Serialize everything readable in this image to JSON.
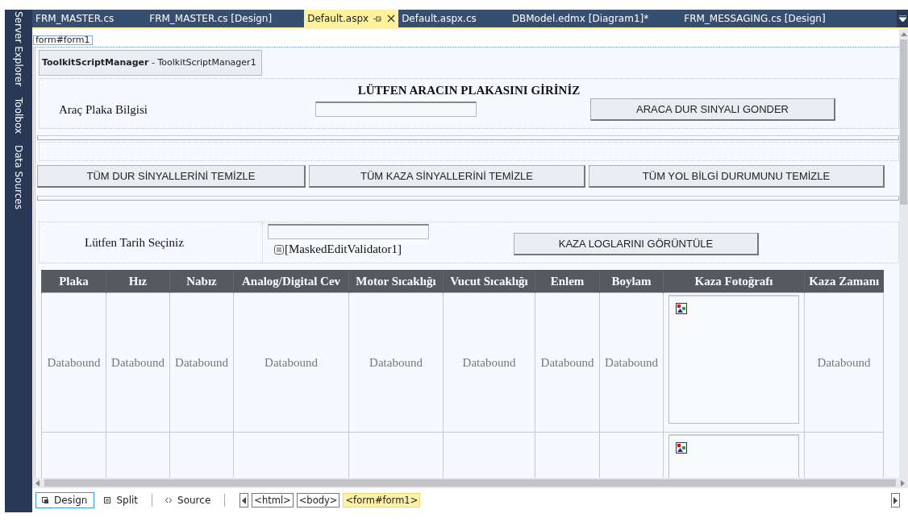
{
  "side_panels": [
    {
      "label": "Server Explorer"
    },
    {
      "label": "Toolbox"
    },
    {
      "label": "Data Sources"
    }
  ],
  "tabs": [
    {
      "label": "FRM_MASTER.cs",
      "selected": false
    },
    {
      "label": "FRM_MASTER.cs [Design]",
      "selected": false
    },
    {
      "label": "Default.aspx",
      "selected": true
    },
    {
      "label": "Default.aspx.cs",
      "selected": false
    },
    {
      "label": "DBModel.edmx [Diagram1]*",
      "selected": false
    },
    {
      "label": "FRM_MESSAGING.cs [Design]",
      "selected": false
    }
  ],
  "designer": {
    "element_tag": "form#form1",
    "script_manager": "**ToolkitScriptManager** - ToolkitScriptManager1",
    "heading": "LÜTFEN ARACIN PLAKASINI GİRİNİZ",
    "plate_label": "Araç Plaka Bilgisi",
    "send_button": "ARACA DUR SINYALI GONDER",
    "clear_buttons": [
      "TÜM DUR SİNYALLERİNİ TEMİZLE",
      "TÜM KAZA SİNYALLERİNİ TEMİZLE",
      "TÜM YOL BİLGİ DURUMUNU TEMİZLE"
    ],
    "date_label": "Lütfen Tarih Seçiniz",
    "validator": "[MaskedEditValidator1]",
    "logs_button": "KAZA LOGLARINI GÖRÜNTÜLE",
    "table": {
      "columns": [
        "Plaka",
        "Hız",
        "Nabız",
        "Analog/Digital Cev",
        "Motor Sıcaklığı",
        "Vucut Sıcaklığı",
        "Enlem",
        "Boylam",
        "Kaza Fotoğrafı",
        "Kaza Zamanı"
      ],
      "rows": [
        {
          "cells": [
            {
              "kind": "text",
              "text": "Databound"
            },
            {
              "kind": "text",
              "text": "Databound"
            },
            {
              "kind": "text",
              "text": "Databound"
            },
            {
              "kind": "text",
              "text": "Databound"
            },
            {
              "kind": "text",
              "text": "Databound"
            },
            {
              "kind": "text",
              "text": "Databound"
            },
            {
              "kind": "text",
              "text": "Databound"
            },
            {
              "kind": "text",
              "text": "Databound"
            },
            {
              "kind": "image"
            },
            {
              "kind": "text",
              "text": "Databound"
            }
          ]
        },
        {
          "cells": [
            {
              "kind": "blank"
            },
            {
              "kind": "blank"
            },
            {
              "kind": "blank"
            },
            {
              "kind": "blank"
            },
            {
              "kind": "blank"
            },
            {
              "kind": "blank"
            },
            {
              "kind": "blank"
            },
            {
              "kind": "blank"
            },
            {
              "kind": "image"
            },
            {
              "kind": "blank"
            }
          ]
        }
      ]
    }
  },
  "view_modes": [
    {
      "label": "Design",
      "selected": true
    },
    {
      "label": "Split",
      "selected": false
    },
    {
      "label": "Source",
      "selected": false
    }
  ],
  "breadcrumbs": [
    {
      "label": "<html>",
      "selected": false
    },
    {
      "label": "<body>",
      "selected": false
    },
    {
      "label": "<form#form1>",
      "selected": true
    }
  ]
}
